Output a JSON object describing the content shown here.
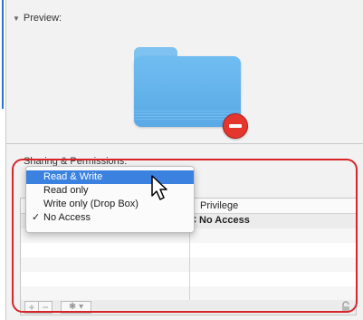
{
  "preview": {
    "title": "Preview:"
  },
  "sharing": {
    "title": "Sharing & Permissions:"
  },
  "table": {
    "privilege_header": "Privilege",
    "rows": [
      {
        "privilege": "No Access"
      }
    ]
  },
  "dropdown": {
    "options": [
      "Read & Write",
      "Read only",
      "Write only (Drop Box)",
      "No Access"
    ],
    "highlighted": "Read & Write",
    "checked": "No Access"
  },
  "toolbar": {
    "add_label": "+",
    "remove_label": "−",
    "action_label": "✱ ▾"
  },
  "colors": {
    "accent": "#3b82e0",
    "annotation": "#d9252a",
    "folder": "#5aa9e6",
    "badge": "#e5362e"
  },
  "icons": [
    "folder-icon",
    "no-entry-badge-icon",
    "lock-icon",
    "gear-icon",
    "pointer-cursor-icon",
    "checkmark-icon"
  ]
}
